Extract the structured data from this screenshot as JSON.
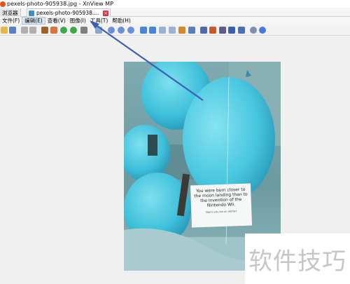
{
  "window": {
    "title": "pexels-photo-905938.jpg - XnView MP"
  },
  "tabs": [
    {
      "label": "浏览器",
      "active": false
    },
    {
      "label": "pexels-photo-905938....",
      "active": true
    }
  ],
  "menu": [
    {
      "label": "文件(F)"
    },
    {
      "label": "编辑(E)",
      "active": true
    },
    {
      "label": "查看(V)"
    },
    {
      "label": "图像(I)"
    },
    {
      "label": "工具(T)"
    },
    {
      "label": "帮助(H)"
    }
  ],
  "toolbar_icons": [
    "open-folder-icon",
    "save-icon",
    "undo-icon",
    "redo-icon",
    "crop-icon",
    "resize-icon",
    "rotate-left-icon",
    "rotate-right-icon",
    "adjust-icon",
    "mail-icon",
    "zoom-in-icon",
    "zoom-fit-icon",
    "zoom-out-icon",
    "prev-icon",
    "next-icon",
    "first-icon",
    "last-icon",
    "slideshow-icon",
    "fullscreen-icon",
    "properties-icon",
    "grid-icon",
    "print-icon",
    "scanner-icon",
    "monitor-icon",
    "settings-icon",
    "help-icon"
  ],
  "photo": {
    "card_text": "You were born closer to the moon landing than to the invention of the Nintendo Wii.",
    "card_subtext": "Damn you are an old fart"
  },
  "watermark": {
    "text": "软件技巧"
  },
  "colors": {
    "accent": "#3a8fc7",
    "balloon": "#4fc8df",
    "arrow": "#3e5fb8",
    "close": "#d9333b"
  }
}
